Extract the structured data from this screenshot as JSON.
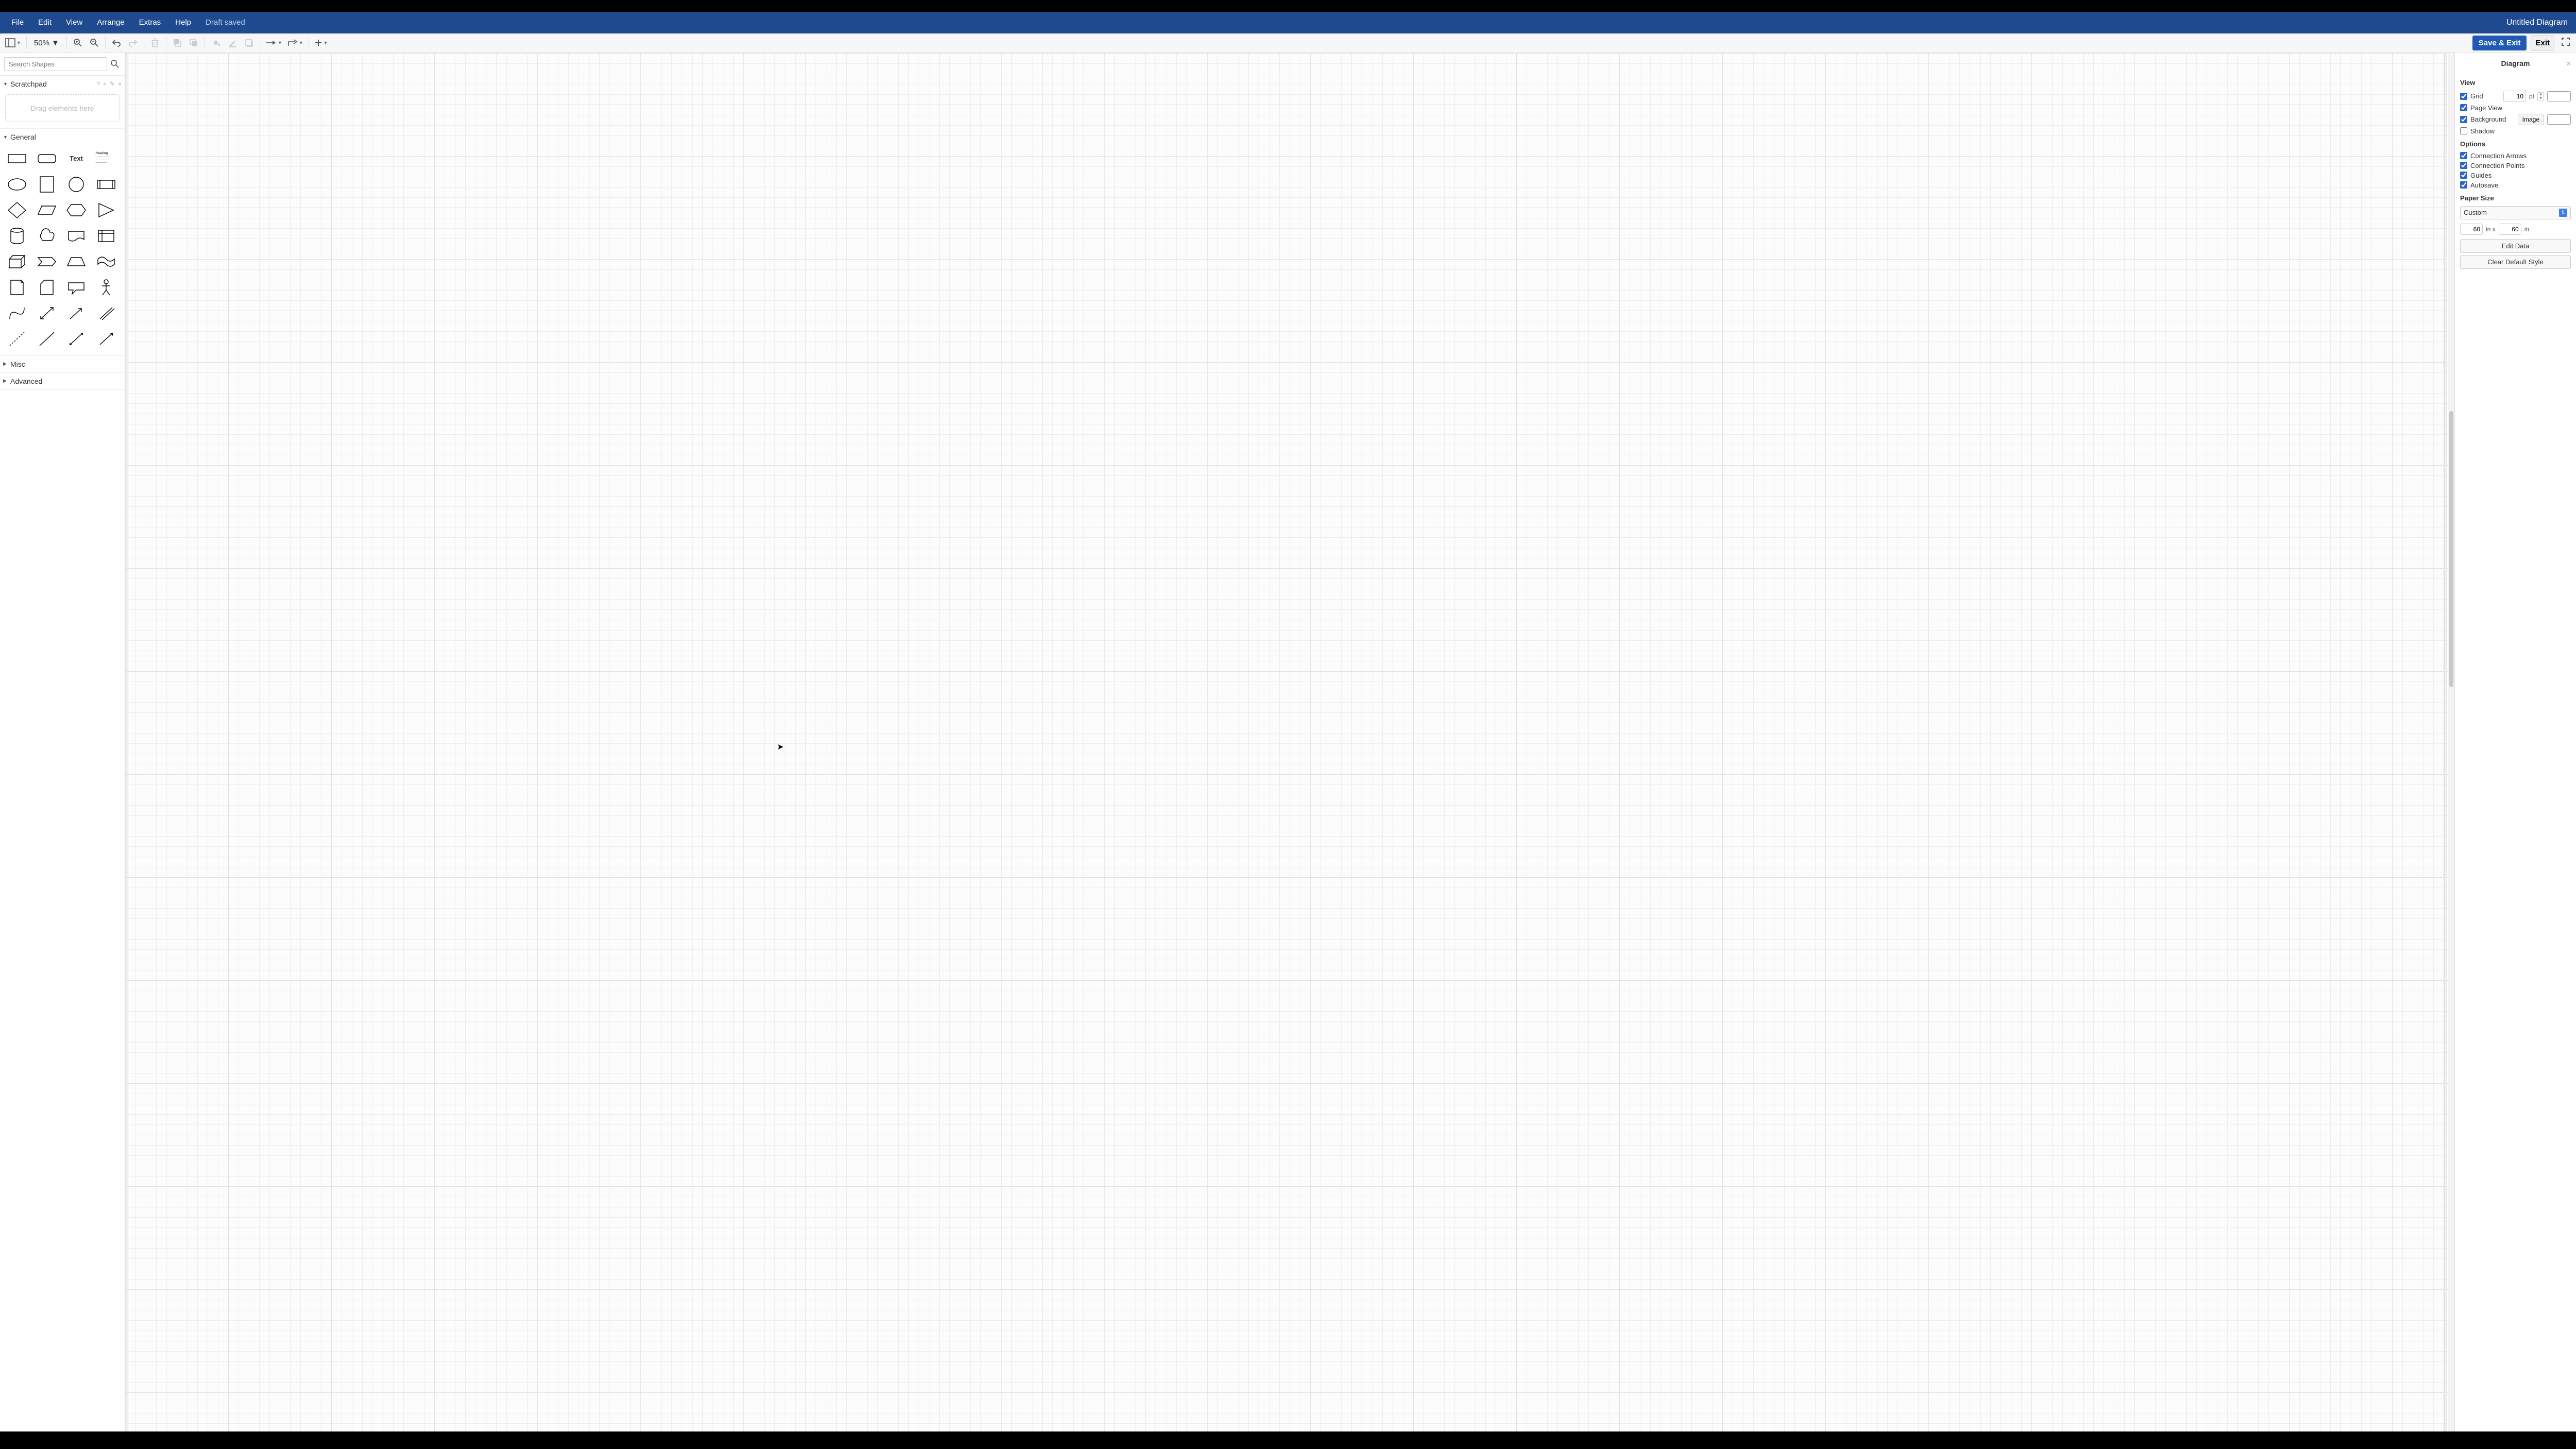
{
  "menubar": {
    "items": [
      "File",
      "Edit",
      "View",
      "Arrange",
      "Extras",
      "Help"
    ],
    "saved_label": "Draft saved",
    "title": "Untitled Diagram"
  },
  "toolbar": {
    "zoom": "50%",
    "save_exit": "Save & Exit",
    "exit": "Exit"
  },
  "sidebar_left": {
    "search_placeholder": "Search Shapes",
    "scratchpad_title": "Scratchpad",
    "scratchpad_hint": "Drag elements here",
    "general_title": "General",
    "misc_title": "Misc",
    "advanced_title": "Advanced",
    "text_label": "Text",
    "heading_label": "Heading"
  },
  "sidebar_right": {
    "header": "Diagram",
    "view_title": "View",
    "grid_label": "Grid",
    "grid_value": "10",
    "grid_unit": "pt",
    "pageview_label": "Page View",
    "background_label": "Background",
    "image_btn": "Image",
    "shadow_label": "Shadow",
    "options_title": "Options",
    "conn_arrows": "Connection Arrows",
    "conn_points": "Connection Points",
    "guides": "Guides",
    "autosave": "Autosave",
    "paper_title": "Paper Size",
    "paper_select": "Custom",
    "width": "60",
    "height": "60",
    "in_x": "in x",
    "in": "in",
    "edit_data": "Edit Data",
    "clear_style": "Clear Default Style"
  }
}
